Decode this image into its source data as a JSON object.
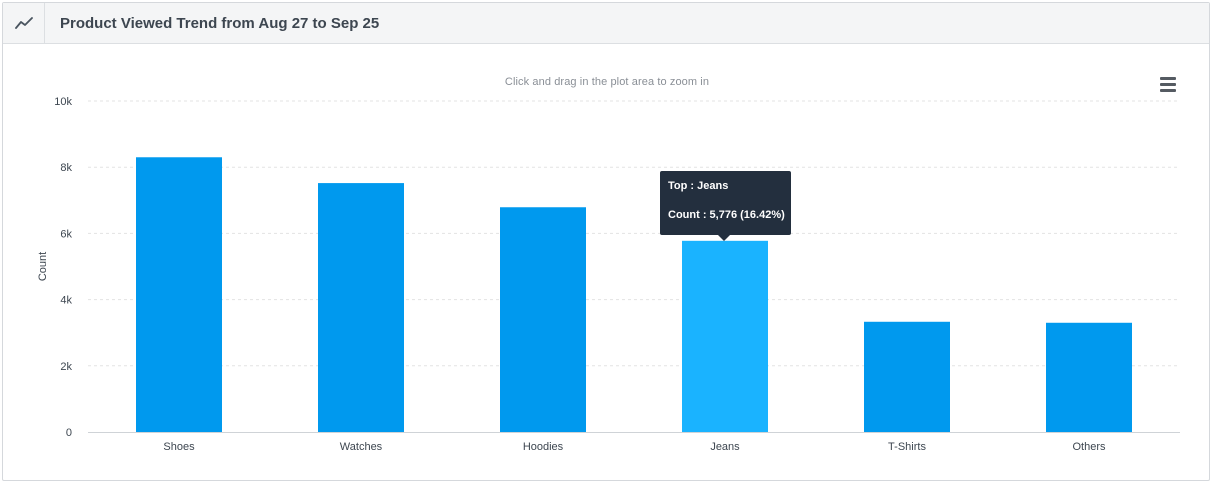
{
  "panel": {
    "title": "Product Viewed Trend from Aug 27 to Sep 25",
    "icon": "line-chart-icon",
    "zoom_hint": "Click and drag in the plot area to zoom in",
    "menu_icon": "hamburger-menu-icon"
  },
  "tooltip": {
    "line1": "Top : Jeans",
    "line2": "Count : 5,776 (16.42%)"
  },
  "chart_data": {
    "type": "bar",
    "categories": [
      "Shoes",
      "Watches",
      "Hoodies",
      "Jeans",
      "T-Shirts",
      "Others"
    ],
    "values": [
      8300,
      7520,
      6790,
      5776,
      3330,
      3300
    ],
    "title": "",
    "xlabel": "",
    "ylabel": "Count",
    "ylim": [
      0,
      10000
    ],
    "yticks": [
      0,
      2000,
      4000,
      6000,
      8000,
      10000
    ],
    "ytick_labels": [
      "0",
      "2k",
      "4k",
      "6k",
      "8k",
      "10k"
    ],
    "grid": true,
    "colors": {
      "bar": "#0099ee",
      "highlight": "#1ab3ff",
      "grid": "#e3e3e3",
      "axis_text": "#3d4650"
    },
    "highlighted_category": "Jeans"
  }
}
